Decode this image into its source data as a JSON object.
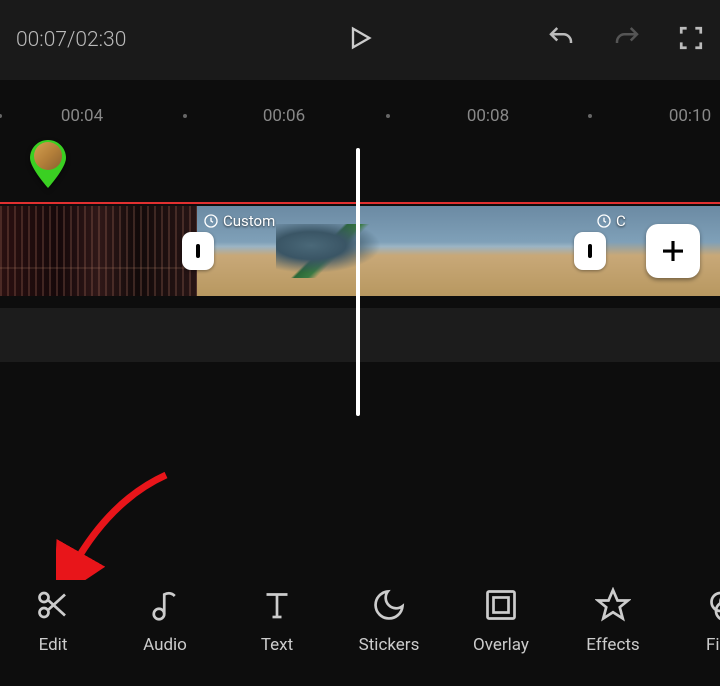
{
  "topbar": {
    "timecode": "00:07/02:30"
  },
  "ruler": {
    "ticks": [
      "00:04",
      "00:06",
      "00:08",
      "00:10"
    ]
  },
  "timeline": {
    "clip2_tag": "Custom",
    "clip3_tag": "C"
  },
  "tools": {
    "edit": "Edit",
    "audio": "Audio",
    "text": "Text",
    "stickers": "Stickers",
    "overlay": "Overlay",
    "effects": "Effects",
    "filters": "Filter"
  },
  "icons": {
    "play": "play-icon",
    "undo": "undo-icon",
    "redo": "redo-icon",
    "fullscreen": "fullscreen-icon",
    "scissors": "scissors-icon",
    "note": "music-note-icon",
    "text": "text-icon",
    "moon": "stickers-icon",
    "overlay": "overlay-icon",
    "star": "effects-icon",
    "filters": "filters-icon",
    "plus": "plus-icon",
    "pin": "marker-pin",
    "clock": "clock-icon"
  }
}
